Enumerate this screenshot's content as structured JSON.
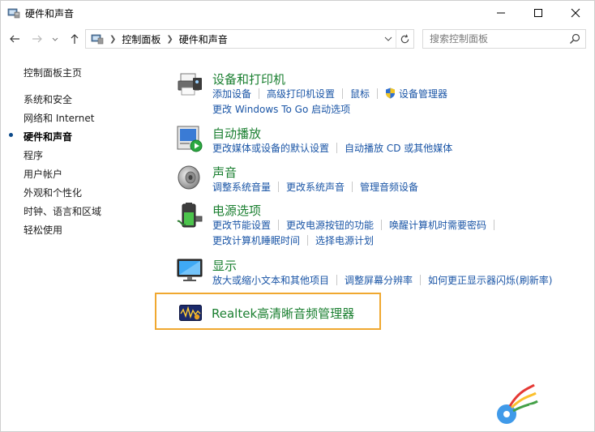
{
  "window": {
    "title": "硬件和声音"
  },
  "address_bar": {
    "crumbs": [
      "控制面板",
      "硬件和声音"
    ],
    "search_placeholder": "搜索控制面板"
  },
  "sidebar": {
    "items": [
      {
        "label": "控制面板主页",
        "active": false
      },
      {
        "label": "系统和安全",
        "active": false
      },
      {
        "label": "网络和 Internet",
        "active": false
      },
      {
        "label": "硬件和声音",
        "active": true
      },
      {
        "label": "程序",
        "active": false
      },
      {
        "label": "用户帐户",
        "active": false
      },
      {
        "label": "外观和个性化",
        "active": false
      },
      {
        "label": "时钟、语言和区域",
        "active": false
      },
      {
        "label": "轻松使用",
        "active": false
      }
    ]
  },
  "categories": [
    {
      "title": "设备和打印机",
      "icon": "printer-icon",
      "links": [
        [
          "添加设备",
          "高级打印机设置",
          "鼠标",
          "设备管理器"
        ],
        [
          "更改 Windows To Go 启动选项"
        ]
      ]
    },
    {
      "title": "自动播放",
      "icon": "autoplay-icon",
      "links": [
        [
          "更改媒体或设备的默认设置",
          "自动播放 CD 或其他媒体"
        ]
      ]
    },
    {
      "title": "声音",
      "icon": "speaker-icon",
      "links": [
        [
          "调整系统音量",
          "更改系统声音",
          "管理音频设备"
        ]
      ]
    },
    {
      "title": "电源选项",
      "icon": "power-battery-icon",
      "links": [
        [
          "更改节能设置",
          "更改电源按钮的功能",
          "唤醒计算机时需要密码"
        ],
        [
          "更改计算机睡眠时间",
          "选择电源计划"
        ]
      ]
    },
    {
      "title": "显示",
      "icon": "monitor-icon",
      "links": [
        [
          "放大或缩小文本和其他项目",
          "调整屏幕分辨率",
          "如何更正显示器闪烁(刷新率)"
        ]
      ]
    }
  ],
  "realtek": {
    "label": "Realtek高清晰音频管理器",
    "icon": "realtek-audio-icon",
    "highlight_color": "#f0a830"
  },
  "colors": {
    "category_title": "#1a7f30",
    "link": "#1a55a6"
  }
}
